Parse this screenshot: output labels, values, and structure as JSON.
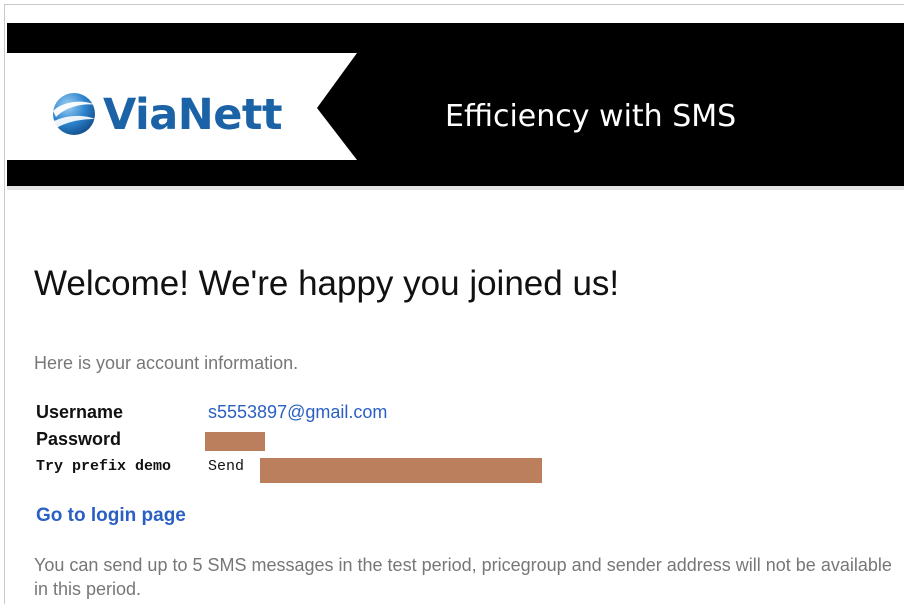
{
  "header": {
    "logo_text": "ViaNett",
    "tagline": "Efficiency with SMS",
    "colors": {
      "banner": "#000000",
      "logo_blue": "#1b63a6"
    }
  },
  "main": {
    "welcome": "Welcome! We're happy you joined us!",
    "intro": "Here is your account information.",
    "account": {
      "username_label": "Username",
      "username_value": "s5553897@gmail.com",
      "password_label": "Password",
      "prefix_label": "Try prefix demo",
      "prefix_send": "Send"
    },
    "login_link": "Go to login page",
    "note": "You can send up to 5 SMS messages in the test period, pricegroup and sender address will not be available in this period."
  },
  "colors": {
    "link": "#2a5fc4",
    "muted_text": "#777777",
    "redaction": "#bb7f5e"
  }
}
